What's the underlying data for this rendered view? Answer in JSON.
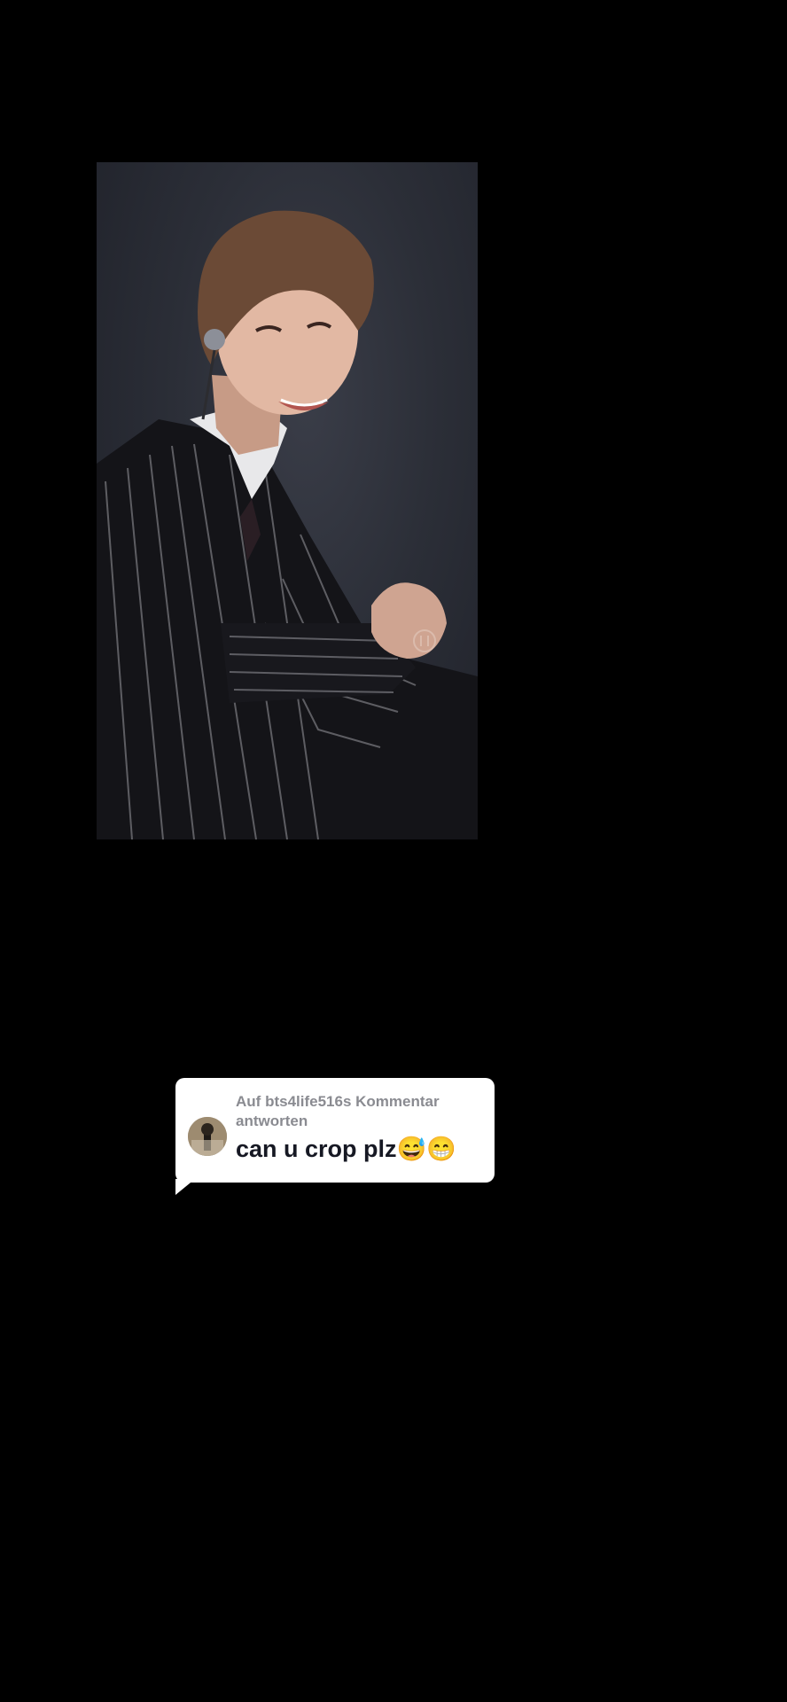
{
  "video": {
    "watermark_icon": "pause-icon",
    "subject_icon": "performer-photo"
  },
  "reply_sticker": {
    "prefix": "Auf",
    "username": "bts4life516s",
    "suffix": "Kommentar antworten",
    "comment": "can u crop plz😅😁",
    "avatar_icon": "user-avatar"
  },
  "colors": {
    "background": "#000000",
    "card": "#ffffff",
    "meta_text": "#8a8b91",
    "comment_text": "#161823"
  }
}
